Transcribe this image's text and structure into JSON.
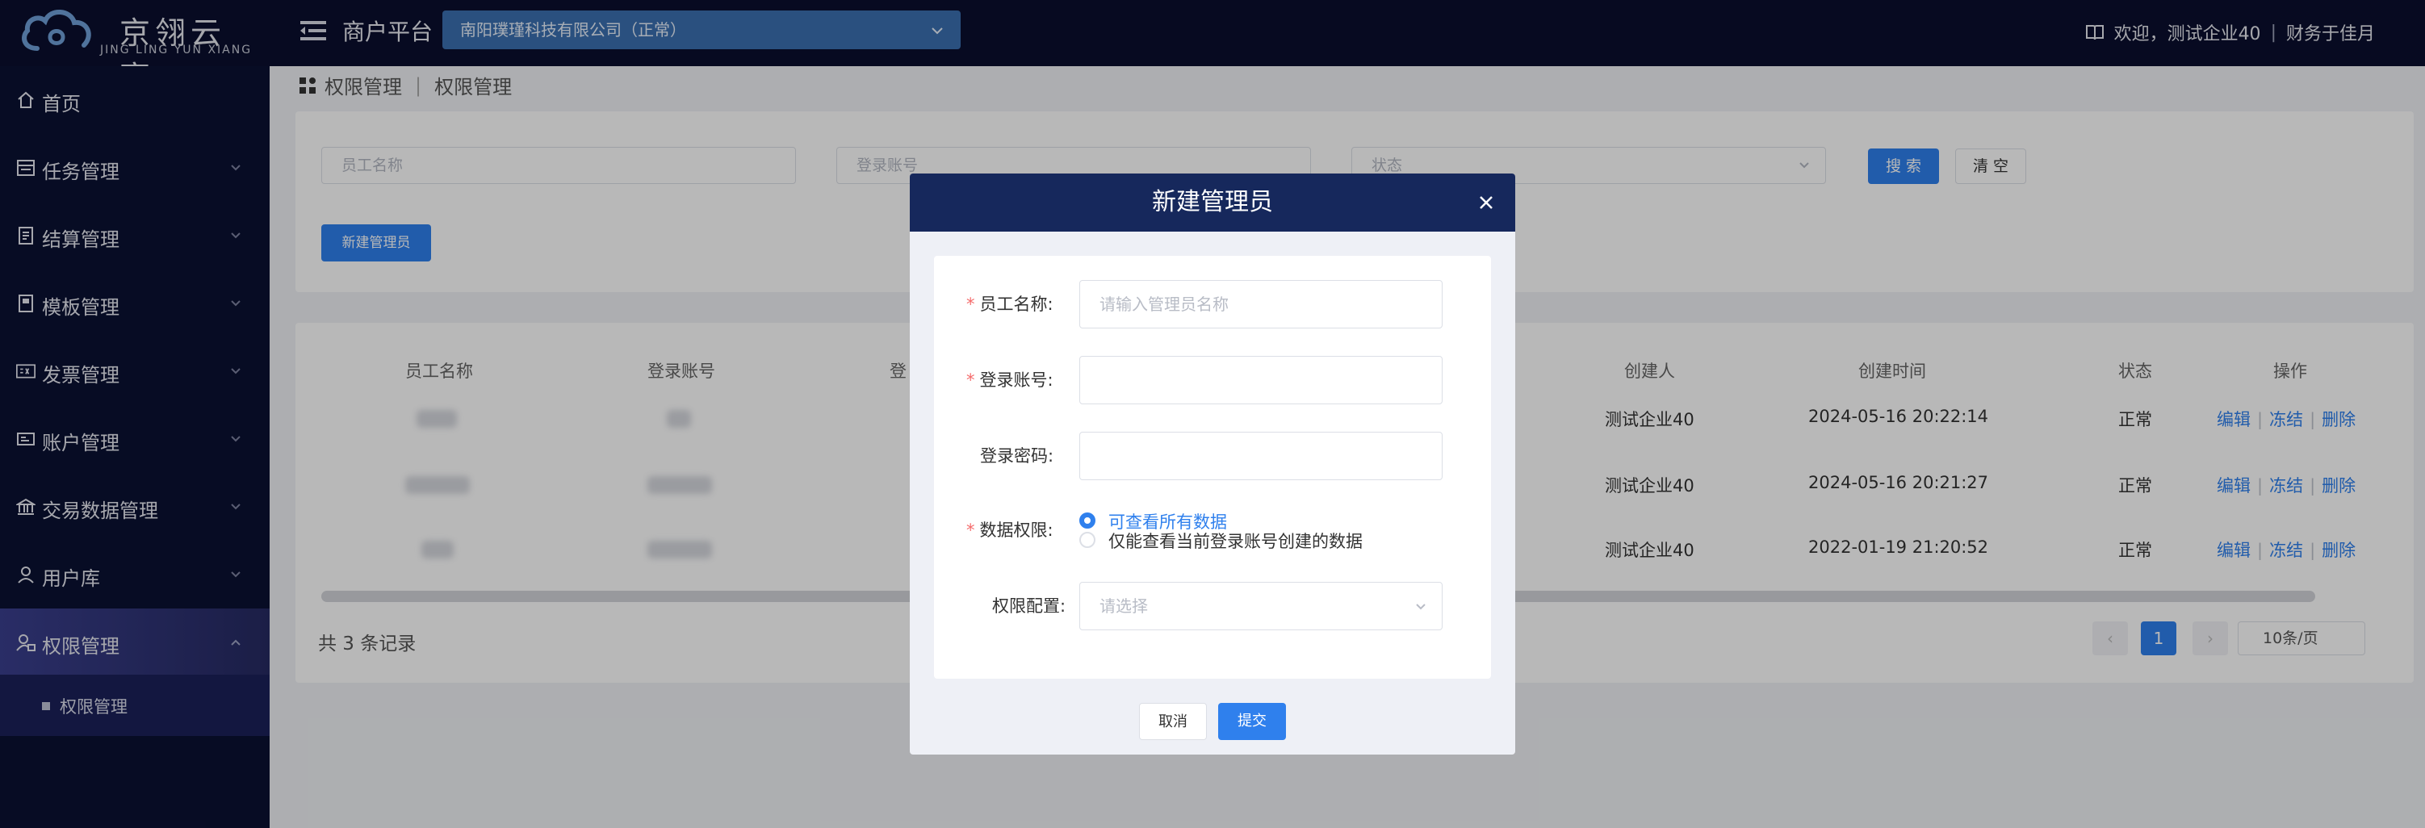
{
  "header": {
    "logo_main": "京翎云享",
    "logo_sub": "JING LING YUN XIANG",
    "platform_title": "商户平台",
    "company_select": "南阳璞瑾科技有限公司（正常）",
    "welcome": "欢迎，测试企业40",
    "user": "财务于佳月"
  },
  "sidebar": {
    "items": [
      {
        "label": "首页"
      },
      {
        "label": "任务管理"
      },
      {
        "label": "结算管理"
      },
      {
        "label": "模板管理"
      },
      {
        "label": "发票管理"
      },
      {
        "label": "账户管理"
      },
      {
        "label": "交易数据管理"
      },
      {
        "label": "用户库"
      },
      {
        "label": "权限管理"
      }
    ],
    "sub_active": "权限管理"
  },
  "breadcrumb": [
    "权限管理",
    "权限管理"
  ],
  "search": {
    "employee_placeholder": "员工名称",
    "account_placeholder": "登录账号",
    "status_placeholder": "状态",
    "search_btn": "搜 索",
    "clear_btn": "清 空",
    "new_admin_btn": "新建管理员"
  },
  "table": {
    "headers": [
      "员工名称",
      "登录账号",
      "登",
      "创建人",
      "创建时间",
      "状态",
      "操作"
    ],
    "rows": [
      {
        "creator": "测试企业40",
        "created_at": "2024-05-16 20:22:14",
        "status": "正常"
      },
      {
        "creator": "测试企业40",
        "created_at": "2024-05-16 20:21:27",
        "status": "正常"
      },
      {
        "creator": "测试企业40",
        "created_at": "2022-01-19 21:20:52",
        "status": "正常"
      }
    ],
    "actions": {
      "edit": "编辑",
      "freeze": "冻结",
      "delete": "删除"
    },
    "total": "共 3 条记录",
    "page": "1",
    "page_size": "10条/页"
  },
  "modal": {
    "title": "新建管理员",
    "fields": {
      "employee_label": "员工名称:",
      "employee_placeholder": "请输入管理员名称",
      "account_label": "登录账号:",
      "password_label": "登录密码:",
      "permission_label": "数据权限:",
      "permission_options": [
        "可查看所有数据",
        "仅能查看当前登录账号创建的数据"
      ],
      "config_label": "权限配置:",
      "config_placeholder": "请选择"
    },
    "cancel": "取消",
    "submit": "提交"
  },
  "colors": {
    "accent": "#2f80ed",
    "header_bg": "#0a0f2e",
    "modal_header": "#16285c",
    "required": "#f56c6c"
  }
}
